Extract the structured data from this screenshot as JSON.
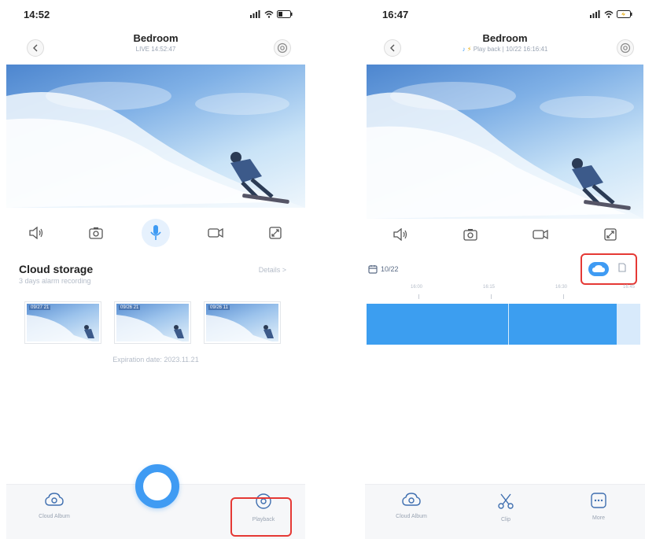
{
  "left_screen": {
    "status_time": "14:52",
    "header": {
      "title": "Bedroom",
      "subtitle": "LIVE 14:52:47"
    },
    "cloud": {
      "title": "Cloud storage",
      "subtitle": "3 days alarm recording",
      "details": "Details >",
      "thumbs": [
        "09/27 21",
        "09/26 21",
        "09/26 11"
      ],
      "expiry": "Expiration date: 2023.11.21"
    },
    "nav": {
      "album": "Cloud Album",
      "playback": "Playback"
    }
  },
  "right_screen": {
    "status_time": "16:47",
    "header": {
      "title": "Bedroom",
      "subtitle": "Play back | 10/22 16:16:41"
    },
    "date": "10/22",
    "ticks": [
      "16:00",
      "16:15",
      "16:30",
      "16:45"
    ],
    "nav": {
      "album": "Cloud Album",
      "clip": "Clip",
      "more": "More"
    }
  },
  "colors": {
    "accent": "#3f9bf3",
    "highlight": "#e53935",
    "timeline": "#3c9ef0"
  }
}
